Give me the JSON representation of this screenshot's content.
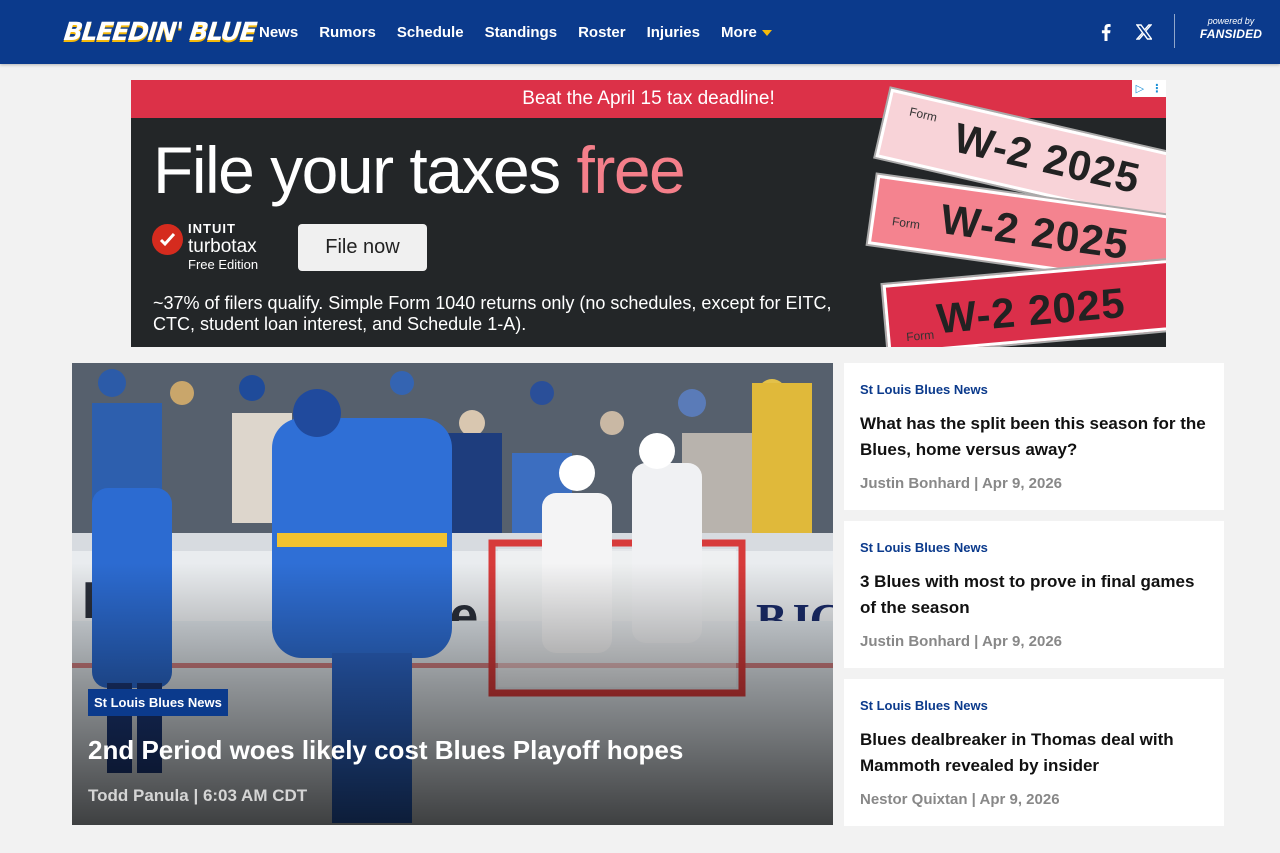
{
  "header": {
    "logo_text": "BLEEDIN' BLUE",
    "nav": [
      "News",
      "Rumors",
      "Schedule",
      "Standings",
      "Roster",
      "Injuries",
      "More"
    ],
    "social_icons": [
      "facebook-icon",
      "x-icon"
    ],
    "powered_by": "powered by",
    "powered_brand": "FANSIDED",
    "accent": "#f5b90a",
    "brand_color": "#0b3a8c"
  },
  "ad": {
    "banner": "Beat the April 15 tax deadline!",
    "headline_main": "File your taxes ",
    "headline_accent": "free",
    "brand_line1": "INTUIT",
    "brand_line2": "turbotax",
    "brand_line3": "Free Edition",
    "cta": "File now",
    "fine_print": "~37% of filers qualify. Simple Form 1040 returns only (no schedules, except for EITC, CTC, student loan interest, and Schedule 1-A).",
    "form_label": "Form",
    "form_title": "W-2 2025"
  },
  "hero": {
    "category": "St Louis Blues News",
    "title": "2nd Period woes likely cost Blues Playoff hopes",
    "meta": "Todd Panula | 6:03 AM CDT"
  },
  "cards": [
    {
      "category": "St Louis Blues News",
      "title": "What has the split been this season for the Blues, home versus away?",
      "meta": "Justin Bonhard | Apr 9, 2026"
    },
    {
      "category": "St Louis Blues News",
      "title": "3 Blues with most to prove in final games of the season",
      "meta": "Justin Bonhard | Apr 9, 2026"
    },
    {
      "category": "St Louis Blues News",
      "title": "Blues dealbreaker in Thomas deal with Mammoth revealed by insider",
      "meta": "Nestor Quixtan | Apr 9, 2026"
    }
  ]
}
